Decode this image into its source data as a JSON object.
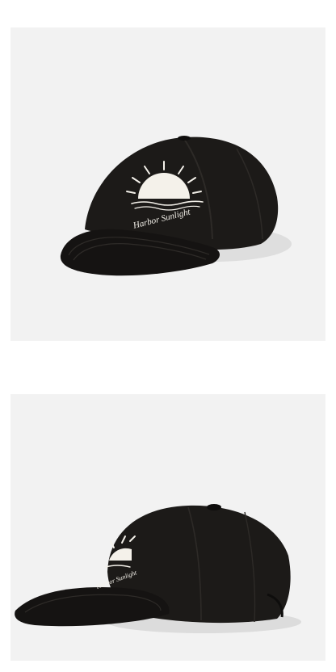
{
  "product": {
    "name": "black baseball cap with embroidered sun logo",
    "colors": {
      "page_background": "#ffffff",
      "photo_background": "#f2f2f2",
      "cap_body": "#1c1a18",
      "cap_shadow": "#0e0d0c",
      "embroidery": "#f4f1ea"
    }
  },
  "photos": [
    {
      "view": "front three-quarter",
      "embroidery_text": "Harbor Sunlight"
    },
    {
      "view": "side profile",
      "embroidery_text": "Harbor Sunlight"
    }
  ]
}
